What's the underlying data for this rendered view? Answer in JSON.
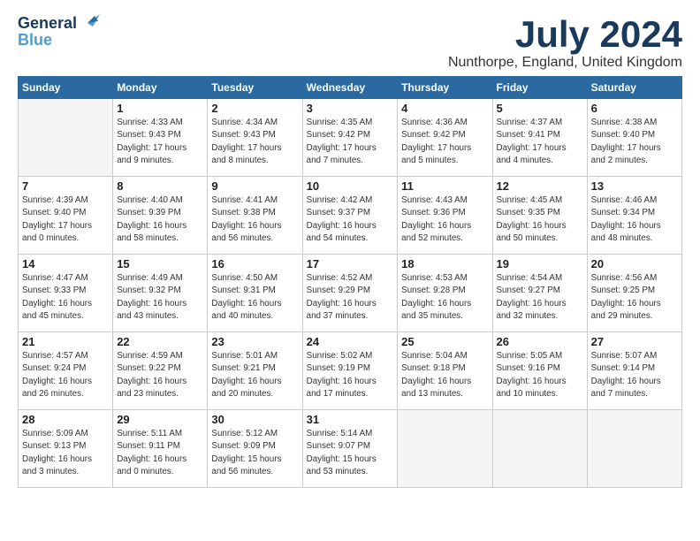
{
  "header": {
    "logo_line1": "General",
    "logo_line2": "Blue",
    "month_title": "July 2024",
    "location": "Nunthorpe, England, United Kingdom"
  },
  "weekdays": [
    "Sunday",
    "Monday",
    "Tuesday",
    "Wednesday",
    "Thursday",
    "Friday",
    "Saturday"
  ],
  "weeks": [
    [
      {
        "day": "",
        "content": ""
      },
      {
        "day": "1",
        "content": "Sunrise: 4:33 AM\nSunset: 9:43 PM\nDaylight: 17 hours\nand 9 minutes."
      },
      {
        "day": "2",
        "content": "Sunrise: 4:34 AM\nSunset: 9:43 PM\nDaylight: 17 hours\nand 8 minutes."
      },
      {
        "day": "3",
        "content": "Sunrise: 4:35 AM\nSunset: 9:42 PM\nDaylight: 17 hours\nand 7 minutes."
      },
      {
        "day": "4",
        "content": "Sunrise: 4:36 AM\nSunset: 9:42 PM\nDaylight: 17 hours\nand 5 minutes."
      },
      {
        "day": "5",
        "content": "Sunrise: 4:37 AM\nSunset: 9:41 PM\nDaylight: 17 hours\nand 4 minutes."
      },
      {
        "day": "6",
        "content": "Sunrise: 4:38 AM\nSunset: 9:40 PM\nDaylight: 17 hours\nand 2 minutes."
      }
    ],
    [
      {
        "day": "7",
        "content": "Sunrise: 4:39 AM\nSunset: 9:40 PM\nDaylight: 17 hours\nand 0 minutes."
      },
      {
        "day": "8",
        "content": "Sunrise: 4:40 AM\nSunset: 9:39 PM\nDaylight: 16 hours\nand 58 minutes."
      },
      {
        "day": "9",
        "content": "Sunrise: 4:41 AM\nSunset: 9:38 PM\nDaylight: 16 hours\nand 56 minutes."
      },
      {
        "day": "10",
        "content": "Sunrise: 4:42 AM\nSunset: 9:37 PM\nDaylight: 16 hours\nand 54 minutes."
      },
      {
        "day": "11",
        "content": "Sunrise: 4:43 AM\nSunset: 9:36 PM\nDaylight: 16 hours\nand 52 minutes."
      },
      {
        "day": "12",
        "content": "Sunrise: 4:45 AM\nSunset: 9:35 PM\nDaylight: 16 hours\nand 50 minutes."
      },
      {
        "day": "13",
        "content": "Sunrise: 4:46 AM\nSunset: 9:34 PM\nDaylight: 16 hours\nand 48 minutes."
      }
    ],
    [
      {
        "day": "14",
        "content": "Sunrise: 4:47 AM\nSunset: 9:33 PM\nDaylight: 16 hours\nand 45 minutes."
      },
      {
        "day": "15",
        "content": "Sunrise: 4:49 AM\nSunset: 9:32 PM\nDaylight: 16 hours\nand 43 minutes."
      },
      {
        "day": "16",
        "content": "Sunrise: 4:50 AM\nSunset: 9:31 PM\nDaylight: 16 hours\nand 40 minutes."
      },
      {
        "day": "17",
        "content": "Sunrise: 4:52 AM\nSunset: 9:29 PM\nDaylight: 16 hours\nand 37 minutes."
      },
      {
        "day": "18",
        "content": "Sunrise: 4:53 AM\nSunset: 9:28 PM\nDaylight: 16 hours\nand 35 minutes."
      },
      {
        "day": "19",
        "content": "Sunrise: 4:54 AM\nSunset: 9:27 PM\nDaylight: 16 hours\nand 32 minutes."
      },
      {
        "day": "20",
        "content": "Sunrise: 4:56 AM\nSunset: 9:25 PM\nDaylight: 16 hours\nand 29 minutes."
      }
    ],
    [
      {
        "day": "21",
        "content": "Sunrise: 4:57 AM\nSunset: 9:24 PM\nDaylight: 16 hours\nand 26 minutes."
      },
      {
        "day": "22",
        "content": "Sunrise: 4:59 AM\nSunset: 9:22 PM\nDaylight: 16 hours\nand 23 minutes."
      },
      {
        "day": "23",
        "content": "Sunrise: 5:01 AM\nSunset: 9:21 PM\nDaylight: 16 hours\nand 20 minutes."
      },
      {
        "day": "24",
        "content": "Sunrise: 5:02 AM\nSunset: 9:19 PM\nDaylight: 16 hours\nand 17 minutes."
      },
      {
        "day": "25",
        "content": "Sunrise: 5:04 AM\nSunset: 9:18 PM\nDaylight: 16 hours\nand 13 minutes."
      },
      {
        "day": "26",
        "content": "Sunrise: 5:05 AM\nSunset: 9:16 PM\nDaylight: 16 hours\nand 10 minutes."
      },
      {
        "day": "27",
        "content": "Sunrise: 5:07 AM\nSunset: 9:14 PM\nDaylight: 16 hours\nand 7 minutes."
      }
    ],
    [
      {
        "day": "28",
        "content": "Sunrise: 5:09 AM\nSunset: 9:13 PM\nDaylight: 16 hours\nand 3 minutes."
      },
      {
        "day": "29",
        "content": "Sunrise: 5:11 AM\nSunset: 9:11 PM\nDaylight: 16 hours\nand 0 minutes."
      },
      {
        "day": "30",
        "content": "Sunrise: 5:12 AM\nSunset: 9:09 PM\nDaylight: 15 hours\nand 56 minutes."
      },
      {
        "day": "31",
        "content": "Sunrise: 5:14 AM\nSunset: 9:07 PM\nDaylight: 15 hours\nand 53 minutes."
      },
      {
        "day": "",
        "content": ""
      },
      {
        "day": "",
        "content": ""
      },
      {
        "day": "",
        "content": ""
      }
    ]
  ]
}
